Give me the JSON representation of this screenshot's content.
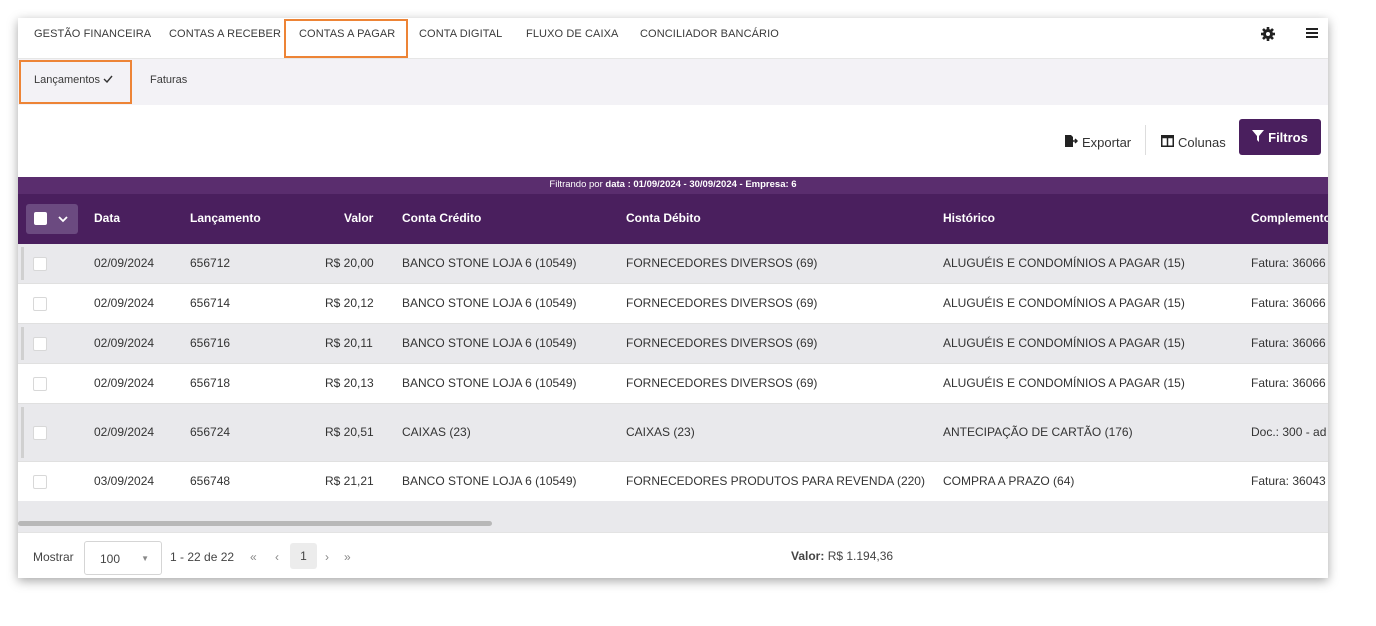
{
  "top_tabs": [
    "GESTÃO FINANCEIRA",
    "CONTAS A RECEBER",
    "CONTAS A PAGAR",
    "CONTA DIGITAL",
    "FLUXO DE CAIXA",
    "CONCILIADOR BANCÁRIO"
  ],
  "active_top_tab": "CONTAS A PAGAR",
  "icons": {
    "settings": "gear-icon",
    "menu": "hamburger-icon"
  },
  "sub_tabs": {
    "lancamentos": "Lançamentos",
    "faturas": "Faturas"
  },
  "toolbar": {
    "exportar": "Exportar",
    "colunas": "Colunas",
    "filtros": "Filtros"
  },
  "filter_info": {
    "prefix": "Filtrando por",
    "text": "data : 01/09/2024 - 30/09/2024 - Empresa: 6"
  },
  "table": {
    "columns": [
      "Data",
      "Lançamento",
      "Valor",
      "Conta Crédito",
      "Conta Débito",
      "Histórico",
      "Complemento"
    ],
    "rows": [
      [
        "02/09/2024",
        "656712",
        "R$ 20,00",
        "BANCO STONE LOJA 6 (10549)",
        "FORNECEDORES DIVERSOS (69)",
        "ALUGUÉIS E CONDOMÍNIOS A PAGAR (15)",
        "Fatura: 36066"
      ],
      [
        "02/09/2024",
        "656714",
        "R$ 20,12",
        "BANCO STONE LOJA 6 (10549)",
        "FORNECEDORES DIVERSOS (69)",
        "ALUGUÉIS E CONDOMÍNIOS A PAGAR (15)",
        "Fatura: 36066"
      ],
      [
        "02/09/2024",
        "656716",
        "R$ 20,11",
        "BANCO STONE LOJA 6 (10549)",
        "FORNECEDORES DIVERSOS (69)",
        "ALUGUÉIS E CONDOMÍNIOS A PAGAR (15)",
        "Fatura: 36066"
      ],
      [
        "02/09/2024",
        "656718",
        "R$ 20,13",
        "BANCO STONE LOJA 6 (10549)",
        "FORNECEDORES DIVERSOS (69)",
        "ALUGUÉIS E CONDOMÍNIOS A PAGAR (15)",
        "Fatura: 36066"
      ],
      [
        "02/09/2024",
        "656724",
        "R$ 20,51",
        "CAIXAS (23)",
        "CAIXAS (23)",
        "ANTECIPAÇÃO DE CARTÃO (176)",
        "Doc.: 300 - ad"
      ],
      [
        "03/09/2024",
        "656748",
        "R$ 21,21",
        "BANCO STONE LOJA 6 (10549)",
        "FORNECEDORES PRODUTOS PARA REVENDA (220)",
        "COMPRA A PRAZO (64)",
        "Fatura: 36043"
      ]
    ]
  },
  "footer": {
    "mostrar": "Mostrar",
    "page_size": "100",
    "range": "1 - 22 de 22",
    "current_page": "1",
    "valor_label": "Valor:",
    "valor_value": "R$ 1.194,36"
  },
  "colors": {
    "primary": "#4a1f5e",
    "highlight": "#ed8436"
  }
}
